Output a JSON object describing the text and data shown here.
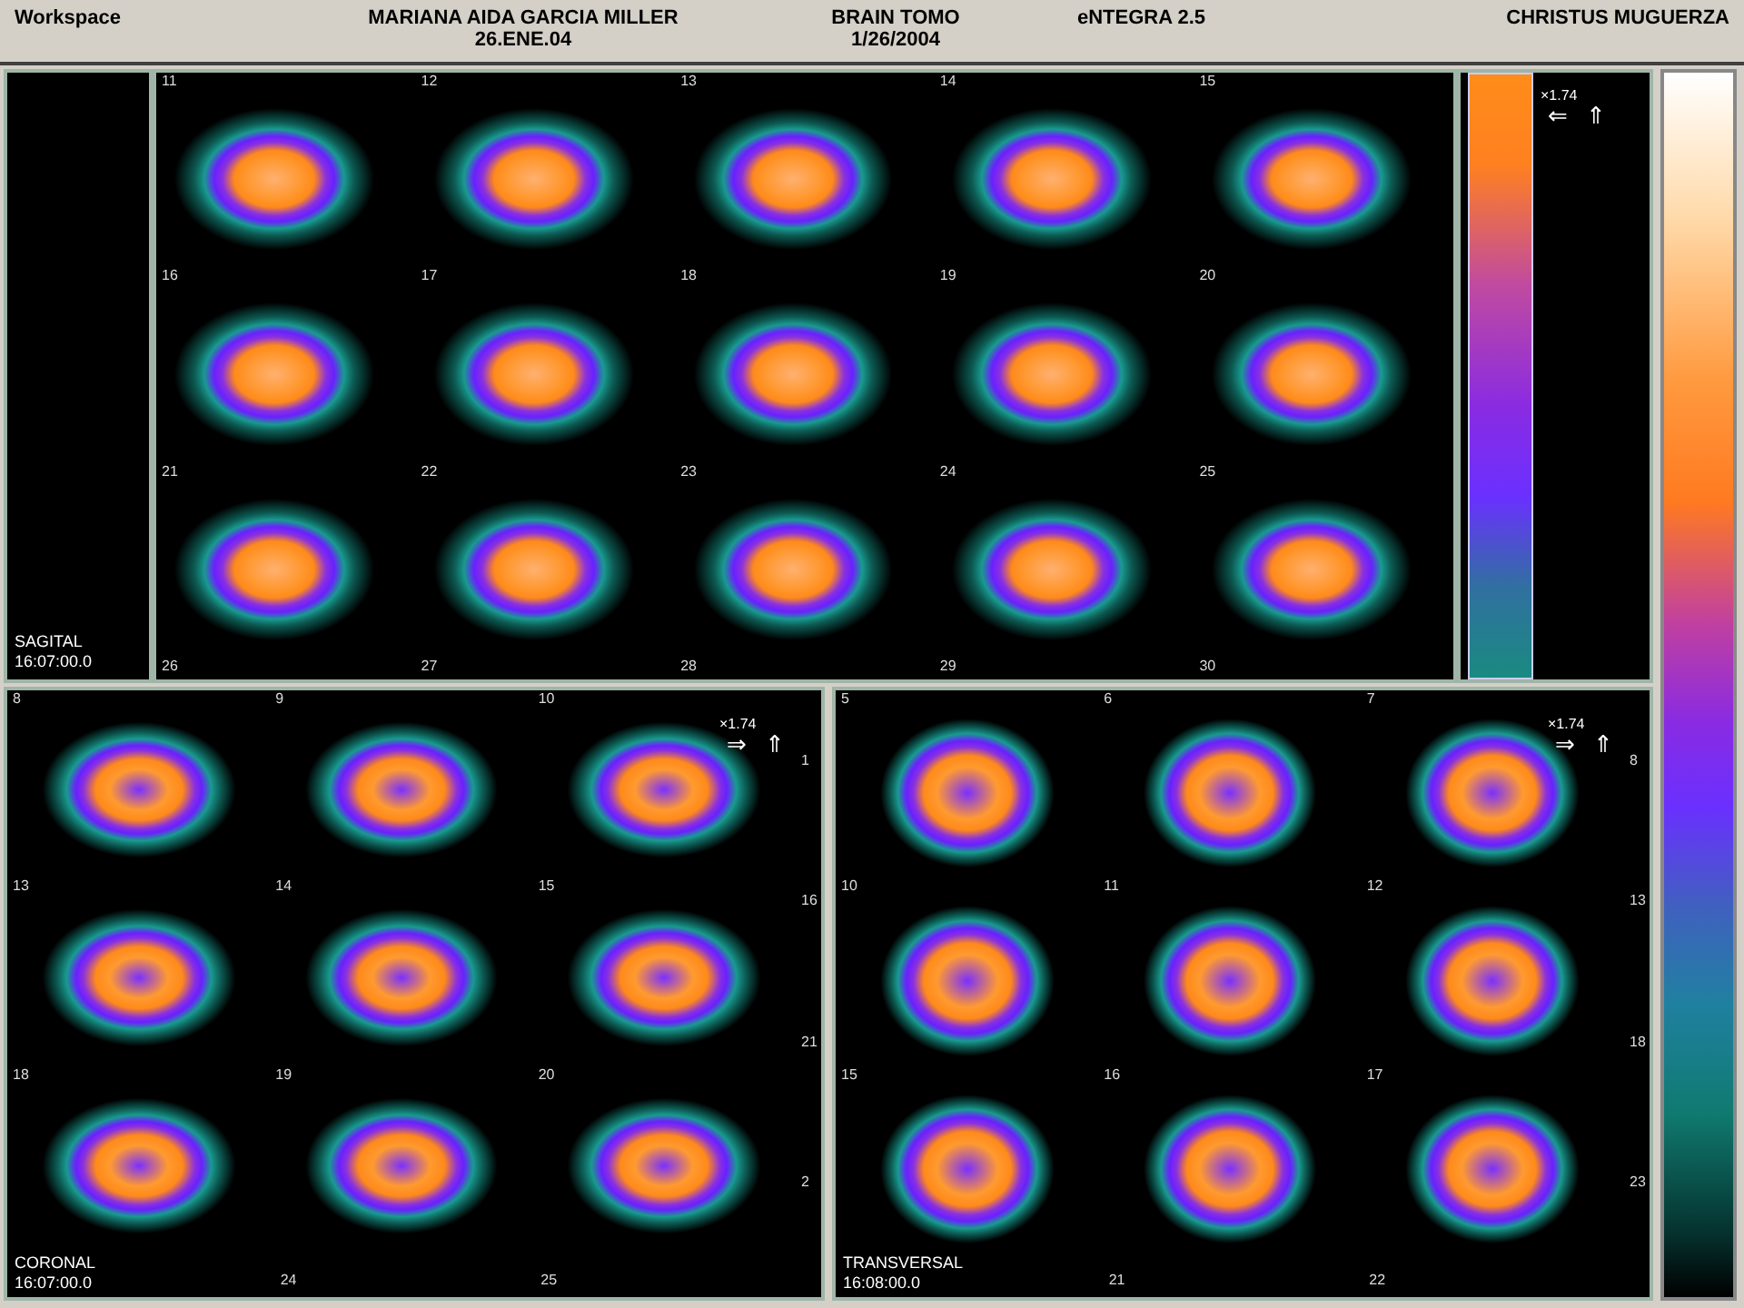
{
  "header": {
    "title": "Workspace",
    "patient_name": "MARIANA AIDA GARCIA MILLER",
    "patient_date": "26.ENE.04",
    "study": "BRAIN TOMO",
    "study_date": "1/26/2004",
    "software": "eNTEGRA 2.5",
    "institution": "CHRISTUS MUGUERZA"
  },
  "panels": [
    {
      "kind": "sagittal",
      "label": "SAGITAL",
      "time": "16:07:00.0",
      "zoom": "×1.74",
      "arrows": [
        "⇐",
        "⇑"
      ],
      "tiles": [
        "11",
        "12",
        "13",
        "14",
        "15",
        "16",
        "17",
        "18",
        "19",
        "20",
        "21",
        "22",
        "23",
        "24",
        "25"
      ],
      "footer_labels": [
        "26",
        "27",
        "28",
        "29",
        "30"
      ]
    },
    {
      "kind": "coronal",
      "label": "CORONAL",
      "time": "16:07:00.0",
      "zoom": "×1.74",
      "arrows": [
        "⇒",
        "⇑"
      ],
      "tiles": [
        "8",
        "9",
        "10",
        "13",
        "14",
        "15",
        "18",
        "19",
        "20"
      ],
      "footer_labels": [
        "24",
        "25"
      ],
      "edge_labels": [
        "1",
        "16",
        "21",
        "2"
      ]
    },
    {
      "kind": "transversal",
      "label": "TRANSVERSAL",
      "time": "16:08:00.0",
      "zoom": "×1.74",
      "arrows": [
        "⇒",
        "⇑"
      ],
      "tiles": [
        "5",
        "6",
        "7",
        "10",
        "11",
        "12",
        "15",
        "16",
        "17"
      ],
      "footer_labels": [
        "21",
        "22"
      ],
      "edge_labels": [
        "8",
        "13",
        "18",
        "23"
      ]
    }
  ]
}
